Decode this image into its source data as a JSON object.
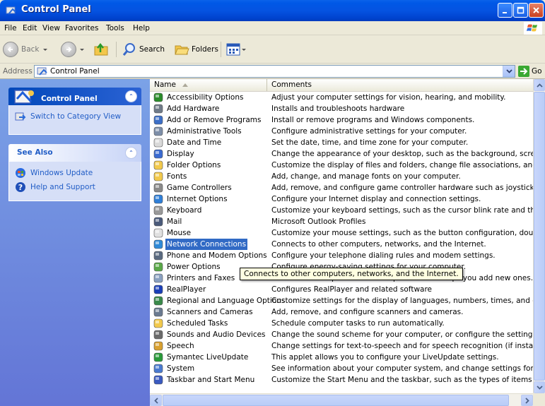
{
  "window": {
    "title": "Control Panel"
  },
  "menu": [
    "File",
    "Edit",
    "View",
    "Favorites",
    "Tools",
    "Help"
  ],
  "toolbar": {
    "back": "Back",
    "search": "Search",
    "folders": "Folders"
  },
  "address": {
    "label": "Address",
    "value": "Control Panel",
    "go": "Go"
  },
  "left": {
    "cp_title": "Control Panel",
    "switch_view": "Switch to Category View",
    "see_also_title": "See Also",
    "see_also": [
      "Windows Update",
      "Help and Support"
    ]
  },
  "columns": {
    "name": "Name",
    "comments": "Comments"
  },
  "items": [
    {
      "name": "Accessibility Options",
      "comment": "Adjust your computer settings for vision, hearing, and mobility.",
      "icon": "accessibility-icon",
      "color": "#2a8b2a"
    },
    {
      "name": "Add Hardware",
      "comment": "Installs and troubleshoots hardware",
      "icon": "add-hardware-icon",
      "color": "#6f7a88"
    },
    {
      "name": "Add or Remove Programs",
      "comment": "Install or remove programs and Windows components.",
      "icon": "add-remove-programs-icon",
      "color": "#3c6fc7"
    },
    {
      "name": "Administrative Tools",
      "comment": "Configure administrative settings for your computer.",
      "icon": "administrative-tools-icon",
      "color": "#7d8ea8"
    },
    {
      "name": "Date and Time",
      "comment": "Set the date, time, and time zone for your computer.",
      "icon": "date-time-icon",
      "color": "#d9d9d9"
    },
    {
      "name": "Display",
      "comment": "Change the appearance of your desktop, such as the background, screen save",
      "icon": "display-icon",
      "color": "#3b6bd1"
    },
    {
      "name": "Folder Options",
      "comment": "Customize the display of files and folders, change file associations, and make ne",
      "icon": "folder-options-icon",
      "color": "#f2c94c"
    },
    {
      "name": "Fonts",
      "comment": "Add, change, and manage fonts on your computer.",
      "icon": "fonts-icon",
      "color": "#f2c94c"
    },
    {
      "name": "Game Controllers",
      "comment": "Add, remove, and configure game controller hardware such as joysticks and gar",
      "icon": "game-controllers-icon",
      "color": "#8a8a8a"
    },
    {
      "name": "Internet Options",
      "comment": "Configure your Internet display and connection settings.",
      "icon": "internet-options-icon",
      "color": "#2f7fd8"
    },
    {
      "name": "Keyboard",
      "comment": "Customize your keyboard settings, such as the cursor blink rate and the charact",
      "icon": "keyboard-icon",
      "color": "#9a9a9a"
    },
    {
      "name": "Mail",
      "comment": "Microsoft Outlook Profiles",
      "icon": "mail-icon",
      "color": "#4a5a7a"
    },
    {
      "name": "Mouse",
      "comment": "Customize your mouse settings, such as the button configuration, double-click s",
      "icon": "mouse-icon",
      "color": "#e0e0e0"
    },
    {
      "name": "Network Connections",
      "comment": "Connects to other computers, networks, and the Internet.",
      "icon": "network-connections-icon",
      "color": "#2f8ad8",
      "selected": true
    },
    {
      "name": "Phone and Modem Options",
      "comment": "Configure your telephone dialing rules and modem settings.",
      "icon": "phone-modem-icon",
      "color": "#5a6a80"
    },
    {
      "name": "Power Options",
      "comment": "Configure energy-saving settings for your computer.",
      "icon": "power-options-icon",
      "color": "#5aa848"
    },
    {
      "name": "Printers and Faxes",
      "comment": "Shows installed printers and fax printers and helps you add new ones.",
      "icon": "printers-faxes-icon",
      "color": "#8aa0c0"
    },
    {
      "name": "RealPlayer",
      "comment": "Configures RealPlayer and related software",
      "icon": "realplayer-icon",
      "color": "#1a3fb8"
    },
    {
      "name": "Regional and Language Options",
      "comment": "Customize settings for the display of languages, numbers, times, and dates.",
      "icon": "regional-language-icon",
      "color": "#3a8a4a"
    },
    {
      "name": "Scanners and Cameras",
      "comment": "Add, remove, and configure scanners and cameras.",
      "icon": "scanners-cameras-icon",
      "color": "#6a7a90"
    },
    {
      "name": "Scheduled Tasks",
      "comment": "Schedule computer tasks to run automatically.",
      "icon": "scheduled-tasks-icon",
      "color": "#f2c94c"
    },
    {
      "name": "Sounds and Audio Devices",
      "comment": "Change the sound scheme for your computer, or configure the settings for your",
      "icon": "sounds-audio-icon",
      "color": "#6a6a6a"
    },
    {
      "name": "Speech",
      "comment": "Change settings for text-to-speech and for speech recognition (if installed).",
      "icon": "speech-icon",
      "color": "#d8a030"
    },
    {
      "name": "Symantec LiveUpdate",
      "comment": "This applet allows you to configure your LiveUpdate settings.",
      "icon": "symantec-liveupdate-icon",
      "color": "#2a9a3a"
    },
    {
      "name": "System",
      "comment": "See information about your computer system, and change settings for hardware",
      "icon": "system-icon",
      "color": "#4a7ad0"
    },
    {
      "name": "Taskbar and Start Menu",
      "comment": "Customize the Start Menu and the taskbar, such as the types of items to be disp",
      "icon": "taskbar-start-menu-icon",
      "color": "#3a5ac0"
    }
  ],
  "tooltip": "Connects to other computers, networks, and the Internet."
}
